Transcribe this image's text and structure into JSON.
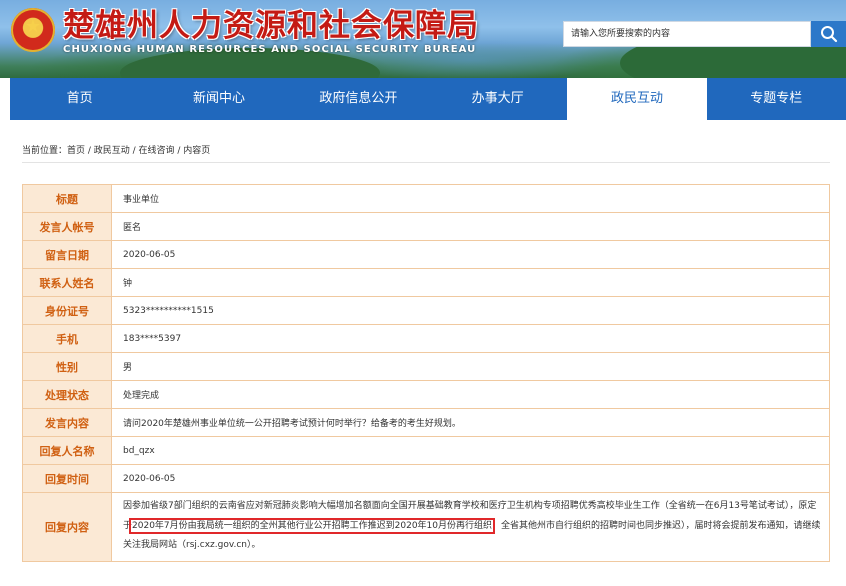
{
  "header": {
    "title": "楚雄州人力资源和社会保障局",
    "subtitle": "CHUXIONG HUMAN RESOURCES AND SOCIAL SECURITY BUREAU",
    "emblem_icon": "national-emblem-icon",
    "search_placeholder": "请输入您所要搜索的内容",
    "search_icon": "search-icon"
  },
  "nav": {
    "items": [
      {
        "label": "首页"
      },
      {
        "label": "新闻中心"
      },
      {
        "label": "政府信息公开"
      },
      {
        "label": "办事大厅"
      },
      {
        "label": "政民互动"
      },
      {
        "label": "专题专栏"
      }
    ],
    "active_index": 4
  },
  "breadcrumb": "当前位置：首页 / 政民互动 / 在线咨询 / 内容页",
  "detail": {
    "rows": [
      {
        "label": "标题",
        "value": "事业单位"
      },
      {
        "label": "发言人帐号",
        "value": "匿名"
      },
      {
        "label": "留言日期",
        "value": "2020-06-05"
      },
      {
        "label": "联系人姓名",
        "value": "钟"
      },
      {
        "label": "身份证号",
        "value": "5323**********1515"
      },
      {
        "label": "手机",
        "value": "183****5397"
      },
      {
        "label": "性别",
        "value": "男"
      },
      {
        "label": "处理状态",
        "value": "处理完成"
      },
      {
        "label": "发言内容",
        "value": "请问2020年楚雄州事业单位统一公开招聘考试预计何时举行？给备考的考生好规划。"
      },
      {
        "label": "回复人名称",
        "value": "bd_qzx"
      },
      {
        "label": "回复时间",
        "value": "2020-06-05"
      }
    ],
    "reply": {
      "label": "回复内容",
      "part1": "因参加省级7部门组织的云南省应对新冠肺炎影响大幅增加名额面向全国开展基础教育学校和医疗卫生机构专项招聘优秀高校毕业生工作（全省统一在6月13号笔试考试），原定于",
      "highlight": "2020年7月份由我局统一组织的全州其他行业公开招聘工作推迟到2020年10月份再行组织",
      "part2": "，全省其他州市自行组织的招聘时间也同步推迟），届时将会提前发布通知，请继续关注我局网站（rsj.cxz.gov.cn）。"
    }
  },
  "colors": {
    "nav_bg": "#2068bd",
    "title_red": "#c41a14",
    "label_bg": "#fbe9d5",
    "label_text": "#d06012",
    "border": "#f0c9a0",
    "highlight_box": "#e0282a"
  }
}
